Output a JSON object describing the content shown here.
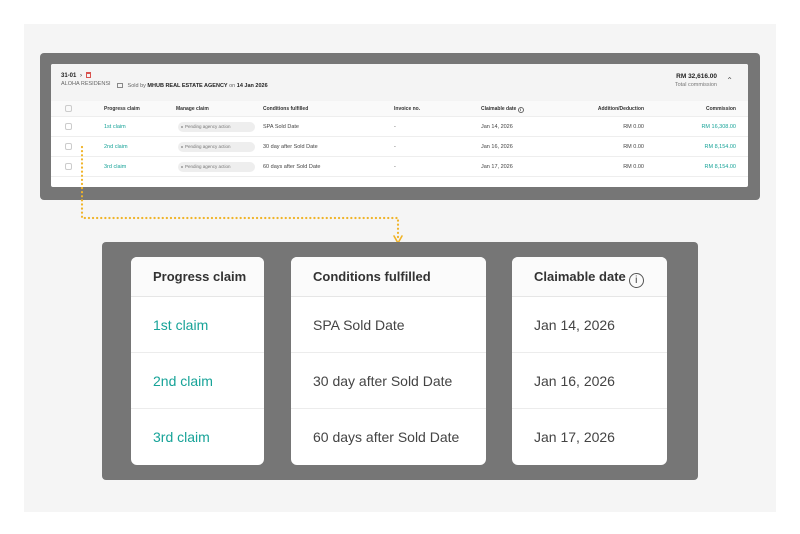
{
  "header": {
    "unit": "31-01",
    "project": "ALOHA RESIDENSI",
    "sold_prefix": "Sold by",
    "agency": "MHUB REAL ESTATE AGENCY",
    "on": "on",
    "sold_date": "14 Jan 2026",
    "total_amount": "RM 32,616.00",
    "total_label": "Total commission"
  },
  "table": {
    "headers": {
      "progress": "Progress claim",
      "manage": "Manage claim",
      "conditions": "Conditions fulfilled",
      "invoice": "Invoice no.",
      "claimable": "Claimable date",
      "addition": "Addition/Deduction",
      "commission": "Commission"
    },
    "rows": [
      {
        "progress": "1st claim",
        "manage": "Pending agency action",
        "conditions": "SPA Sold Date",
        "invoice": "-",
        "claimable": "Jan 14, 2026",
        "addition": "RM 0.00",
        "commission": "RM 16,308.00"
      },
      {
        "progress": "2nd claim",
        "manage": "Pending agency action",
        "conditions": "30 day after Sold Date",
        "invoice": "-",
        "claimable": "Jan 16, 2026",
        "addition": "RM 0.00",
        "commission": "RM 8,154.00"
      },
      {
        "progress": "3rd claim",
        "manage": "Pending agency action",
        "conditions": "60 days after Sold Date",
        "invoice": "-",
        "claimable": "Jan 17, 2026",
        "addition": "RM 0.00",
        "commission": "RM 8,154.00"
      }
    ]
  },
  "zoom": {
    "progress_header": "Progress claim",
    "conditions_header": "Conditions fulfilled",
    "claimable_header": "Claimable date",
    "progress": [
      "1st claim",
      "2nd claim",
      "3rd claim"
    ],
    "conditions": [
      "SPA Sold Date",
      "30 day after Sold Date",
      "60 days after Sold Date"
    ],
    "claimable": [
      "Jan 14, 2026",
      "Jan 16, 2026",
      "Jan 17, 2026"
    ]
  },
  "colors": {
    "accent": "#17a398",
    "frame": "#767676",
    "connector": "#f0b429"
  },
  "icons": [
    "trash-icon",
    "house-icon",
    "chevron-up-icon",
    "info-icon"
  ]
}
